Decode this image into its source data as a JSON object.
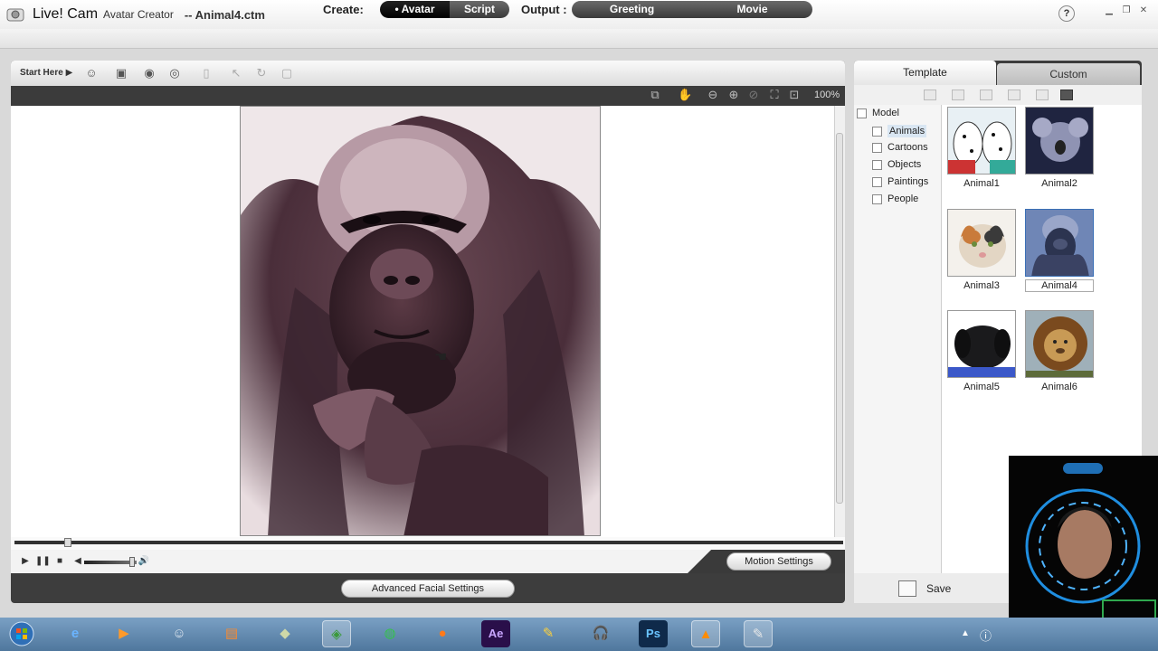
{
  "window": {
    "app_name": "Live! Cam",
    "app_sub": "Avatar Creator",
    "doc_name": "-- Animal4.ctm",
    "help": "?"
  },
  "create_bar": {
    "create_label": "Create:",
    "avatar": "Avatar",
    "script": "Script",
    "output_label": "Output :",
    "greeting": "Greeting",
    "movie": "Movie"
  },
  "toolbar": {
    "start_here": "Start Here",
    "zoom": "100%"
  },
  "player": {
    "motion_settings": "Motion Settings",
    "advanced_facial": "Advanced Facial Settings",
    "timeline_progress": 0.06,
    "volume_level": 0.85
  },
  "right_panel": {
    "tab_template": "Template",
    "tab_custom": "Custom",
    "tree_root": "Model",
    "categories": [
      "Animals",
      "Cartoons",
      "Objects",
      "Paintings",
      "People"
    ],
    "selected_category": "Animals",
    "thumbnails": [
      "Animal1",
      "Animal2",
      "Animal3",
      "Animal4",
      "Animal5",
      "Animal6"
    ],
    "selected_thumbnail": "Animal4",
    "save": "Save"
  },
  "taskbar": {
    "ae_label": "Ae",
    "ps_label": "Ps"
  },
  "colors": {
    "panel_dark": "#3d3d3d",
    "selection_blue": "#3a6fb5",
    "taskbar": "#5b83a9"
  }
}
